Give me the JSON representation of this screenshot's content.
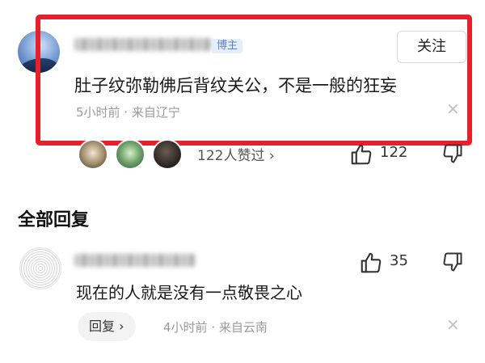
{
  "comment": {
    "author_tag": "博主",
    "follow_label": "关注",
    "text": "肚子纹弥勒佛后背纹关公，不是一般的狂妄",
    "time": "5小时前",
    "separator": " · ",
    "location": "来自辽宁",
    "likers_text": "122人赞过 ›",
    "like_count": "122",
    "close_glyph": "✕"
  },
  "replies_section": {
    "title": "全部回复"
  },
  "reply": {
    "like_count": "35",
    "text": "现在的人就是没有一点敬畏之心",
    "reply_button_label": "回复 ›",
    "time": "4小时前",
    "separator": " · ",
    "location": "来自云南",
    "close_glyph": "✕"
  },
  "colors": {
    "highlight_border": "#e8202c",
    "meta_text": "#9a9a9a",
    "badge_text": "#5b7fd0"
  },
  "icons": [
    "thumbs-up-icon",
    "thumbs-down-icon",
    "close-icon"
  ]
}
